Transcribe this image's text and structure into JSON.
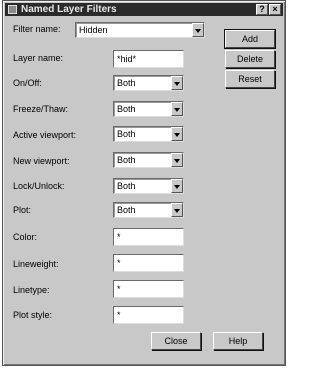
{
  "window": {
    "title": "Named Layer Filters",
    "help_glyph": "?",
    "close_glyph": "×"
  },
  "fields": [
    {
      "id": "filter-name",
      "label": "Filter name:",
      "type": "combo",
      "value": "Hidden"
    },
    {
      "id": "layer-name",
      "label": "Layer name:",
      "type": "text",
      "value": "*hid*"
    },
    {
      "id": "on-off",
      "label": "On/Off:",
      "type": "combo",
      "value": "Both"
    },
    {
      "id": "freeze-thaw",
      "label": "Freeze/Thaw:",
      "type": "combo",
      "value": "Both"
    },
    {
      "id": "active-viewport",
      "label": "Active viewport:",
      "type": "combo",
      "value": "Both"
    },
    {
      "id": "new-viewport",
      "label": "New viewport:",
      "type": "combo",
      "value": "Both"
    },
    {
      "id": "lock-unlock",
      "label": "Lock/Unlock:",
      "type": "combo",
      "value": "Both"
    },
    {
      "id": "plot",
      "label": "Plot:",
      "type": "combo",
      "value": "Both"
    },
    {
      "id": "color",
      "label": "Color:",
      "type": "text",
      "value": "*"
    },
    {
      "id": "lineweight",
      "label": "Lineweight:",
      "type": "text",
      "value": "*"
    },
    {
      "id": "linetype",
      "label": "Linetype:",
      "type": "text",
      "value": "*"
    },
    {
      "id": "plot-style",
      "label": "Plot style:",
      "type": "text",
      "value": "*"
    }
  ],
  "buttons": {
    "add": "Add",
    "delete": "Delete",
    "reset": "Reset",
    "close": "Close",
    "help": "Help"
  }
}
